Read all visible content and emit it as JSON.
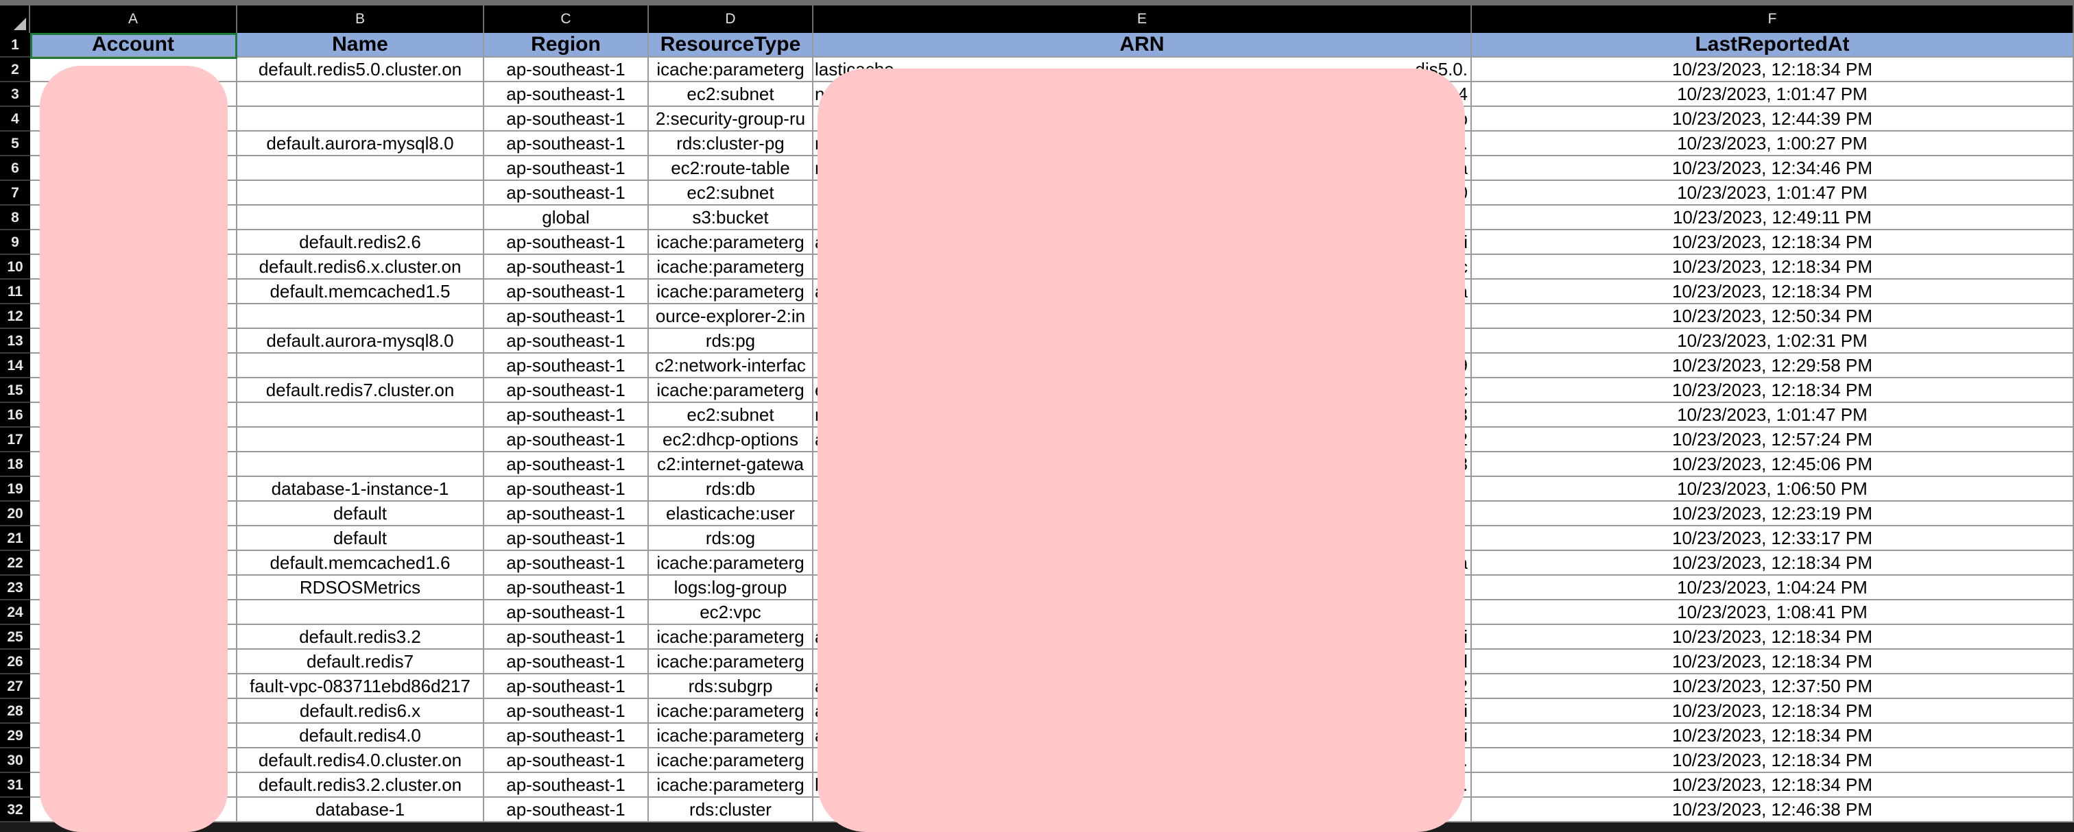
{
  "columns": [
    "A",
    "B",
    "C",
    "D",
    "E",
    "F"
  ],
  "headers": {
    "account": "Account",
    "name": "Name",
    "region": "Region",
    "resource_type": "ResourceType",
    "arn": "ARN",
    "last_reported": "LastReportedAt"
  },
  "row_numbers": [
    "1",
    "2",
    "3",
    "4",
    "5",
    "6",
    "7",
    "8",
    "9",
    "10",
    "11",
    "12",
    "13",
    "14",
    "15",
    "16",
    "17",
    "18",
    "19",
    "20",
    "21",
    "22",
    "23",
    "24",
    "25",
    "26",
    "27",
    "28",
    "29",
    "30",
    "31",
    "32"
  ],
  "rows": [
    {
      "name": "default.redis5.0.cluster.on",
      "region": "ap-southeast-1",
      "type": "icache:parameterg",
      "arn_left": "lasticache",
      "arn_right": "dis5.0.",
      "time": "10/23/2023, 12:18:34 PM"
    },
    {
      "name": "",
      "region": "ap-southeast-1",
      "type": "ec2:subnet",
      "arn_left": "n",
      "arn_right": "84",
      "time": "10/23/2023, 1:01:47 PM"
    },
    {
      "name": "",
      "region": "ap-southeast-1",
      "type": "2:security-group-ru",
      "arn_left": "",
      "arn_right": "b",
      "time": "10/23/2023, 12:44:39 PM"
    },
    {
      "name": "default.aurora-mysql8.0",
      "region": "ap-southeast-1",
      "type": "rds:cluster-pg",
      "arn_left": "n",
      "arn_right": ".",
      "time": "10/23/2023, 1:00:27 PM"
    },
    {
      "name": "",
      "region": "ap-southeast-1",
      "type": "ec2:route-table",
      "arn_left": "n",
      "arn_right": "a",
      "time": "10/23/2023, 12:34:46 PM"
    },
    {
      "name": "",
      "region": "ap-southeast-1",
      "type": "ec2:subnet",
      "arn_left": "",
      "arn_right": "0",
      "time": "10/23/2023, 1:01:47 PM"
    },
    {
      "name": "",
      "region": "global",
      "type": "s3:bucket",
      "arn_left": "",
      "arn_right": "",
      "time": "10/23/2023, 12:49:11 PM"
    },
    {
      "name": "default.redis2.6",
      "region": "ap-southeast-1",
      "type": "icache:parameterg",
      "arn_left": "a",
      "arn_right": "li",
      "time": "10/23/2023, 12:18:34 PM"
    },
    {
      "name": "default.redis6.x.cluster.on",
      "region": "ap-southeast-1",
      "type": "icache:parameterg",
      "arn_left": "",
      "arn_right": ".c",
      "time": "10/23/2023, 12:18:34 PM"
    },
    {
      "name": "default.memcached1.5",
      "region": "ap-southeast-1",
      "type": "icache:parameterg",
      "arn_left": "a",
      "arn_right": "a",
      "time": "10/23/2023, 12:18:34 PM"
    },
    {
      "name": "",
      "region": "ap-southeast-1",
      "type": "ource-explorer-2:in",
      "arn_left": "",
      "arn_right": "",
      "time": "10/23/2023, 12:50:34 PM"
    },
    {
      "name": "default.aurora-mysql8.0",
      "region": "ap-southeast-1",
      "type": "rds:pg",
      "arn_left": "",
      "arn_right": "",
      "time": "10/23/2023, 1:02:31 PM"
    },
    {
      "name": "",
      "region": "ap-southeast-1",
      "type": "c2:network-interfac",
      "arn_left": "",
      "arn_right": "9",
      "time": "10/23/2023, 12:29:58 PM"
    },
    {
      "name": "default.redis7.cluster.on",
      "region": "ap-southeast-1",
      "type": "icache:parameterg",
      "arn_left": "e",
      "arn_right": "c",
      "time": "10/23/2023, 12:18:34 PM"
    },
    {
      "name": "",
      "region": "ap-southeast-1",
      "type": "ec2:subnet",
      "arn_left": "n",
      "arn_right": "3",
      "time": "10/23/2023, 1:01:47 PM"
    },
    {
      "name": "",
      "region": "ap-southeast-1",
      "type": "ec2:dhcp-options",
      "arn_left": "a",
      "arn_right": "2",
      "time": "10/23/2023, 12:57:24 PM"
    },
    {
      "name": "",
      "region": "ap-southeast-1",
      "type": "c2:internet-gatewa",
      "arn_left": "",
      "arn_right": "8",
      "time": "10/23/2023, 12:45:06 PM"
    },
    {
      "name": "database-1-instance-1",
      "region": "ap-southeast-1",
      "type": "rds:db",
      "arn_left": "",
      "arn_right": "",
      "time": "10/23/2023, 1:06:50 PM"
    },
    {
      "name": "default",
      "region": "ap-southeast-1",
      "type": "elasticache:user",
      "arn_left": "",
      "arn_right": "",
      "time": "10/23/2023, 12:23:19 PM"
    },
    {
      "name": "default",
      "region": "ap-southeast-1",
      "type": "rds:og",
      "arn_left": "",
      "arn_right": "",
      "time": "10/23/2023, 12:33:17 PM"
    },
    {
      "name": "default.memcached1.6",
      "region": "ap-southeast-1",
      "type": "icache:parameterg",
      "arn_left": "",
      "arn_right": "a",
      "time": "10/23/2023, 12:18:34 PM"
    },
    {
      "name": "RDSOSMetrics",
      "region": "ap-southeast-1",
      "type": "logs:log-group",
      "arn_left": "",
      "arn_right": "",
      "time": "10/23/2023, 1:04:24 PM"
    },
    {
      "name": "",
      "region": "ap-southeast-1",
      "type": "ec2:vpc",
      "arn_left": "",
      "arn_right": "",
      "time": "10/23/2023, 1:08:41 PM"
    },
    {
      "name": "default.redis3.2",
      "region": "ap-southeast-1",
      "type": "icache:parameterg",
      "arn_left": "a",
      "arn_right": "li",
      "time": "10/23/2023, 12:18:34 PM"
    },
    {
      "name": "default.redis7",
      "region": "ap-southeast-1",
      "type": "icache:parameterg",
      "arn_left": "",
      "arn_right": "d",
      "time": "10/23/2023, 12:18:34 PM"
    },
    {
      "name": "fault-vpc-083711ebd86d217",
      "region": "ap-southeast-1",
      "type": "rds:subgrp",
      "arn_left": "a",
      "arn_right": "2",
      "time": "10/23/2023, 12:37:50 PM"
    },
    {
      "name": "default.redis6.x",
      "region": "ap-southeast-1",
      "type": "icache:parameterg",
      "arn_left": "a",
      "arn_right": "li",
      "time": "10/23/2023, 12:18:34 PM"
    },
    {
      "name": "default.redis4.0",
      "region": "ap-southeast-1",
      "type": "icache:parameterg",
      "arn_left": "a",
      "arn_right": "li",
      "time": "10/23/2023, 12:18:34 PM"
    },
    {
      "name": "default.redis4.0.cluster.on",
      "region": "ap-southeast-1",
      "type": "icache:parameterg",
      "arn_left": "",
      "arn_right": ".",
      "time": "10/23/2023, 12:18:34 PM"
    },
    {
      "name": "default.redis3.2.cluster.on",
      "region": "ap-southeast-1",
      "type": "icache:parameterg",
      "arn_left": "l",
      "arn_right": ".",
      "time": "10/23/2023, 12:18:34 PM"
    },
    {
      "name": "database-1",
      "region": "ap-southeast-1",
      "type": "rds:cluster",
      "arn_left": "",
      "arn_right": "",
      "time": "10/23/2023, 12:46:38 PM"
    }
  ],
  "colors": {
    "header_fill": "#8eaadb",
    "redaction": "#ffc7c7",
    "selection": "#1f7a3a"
  }
}
